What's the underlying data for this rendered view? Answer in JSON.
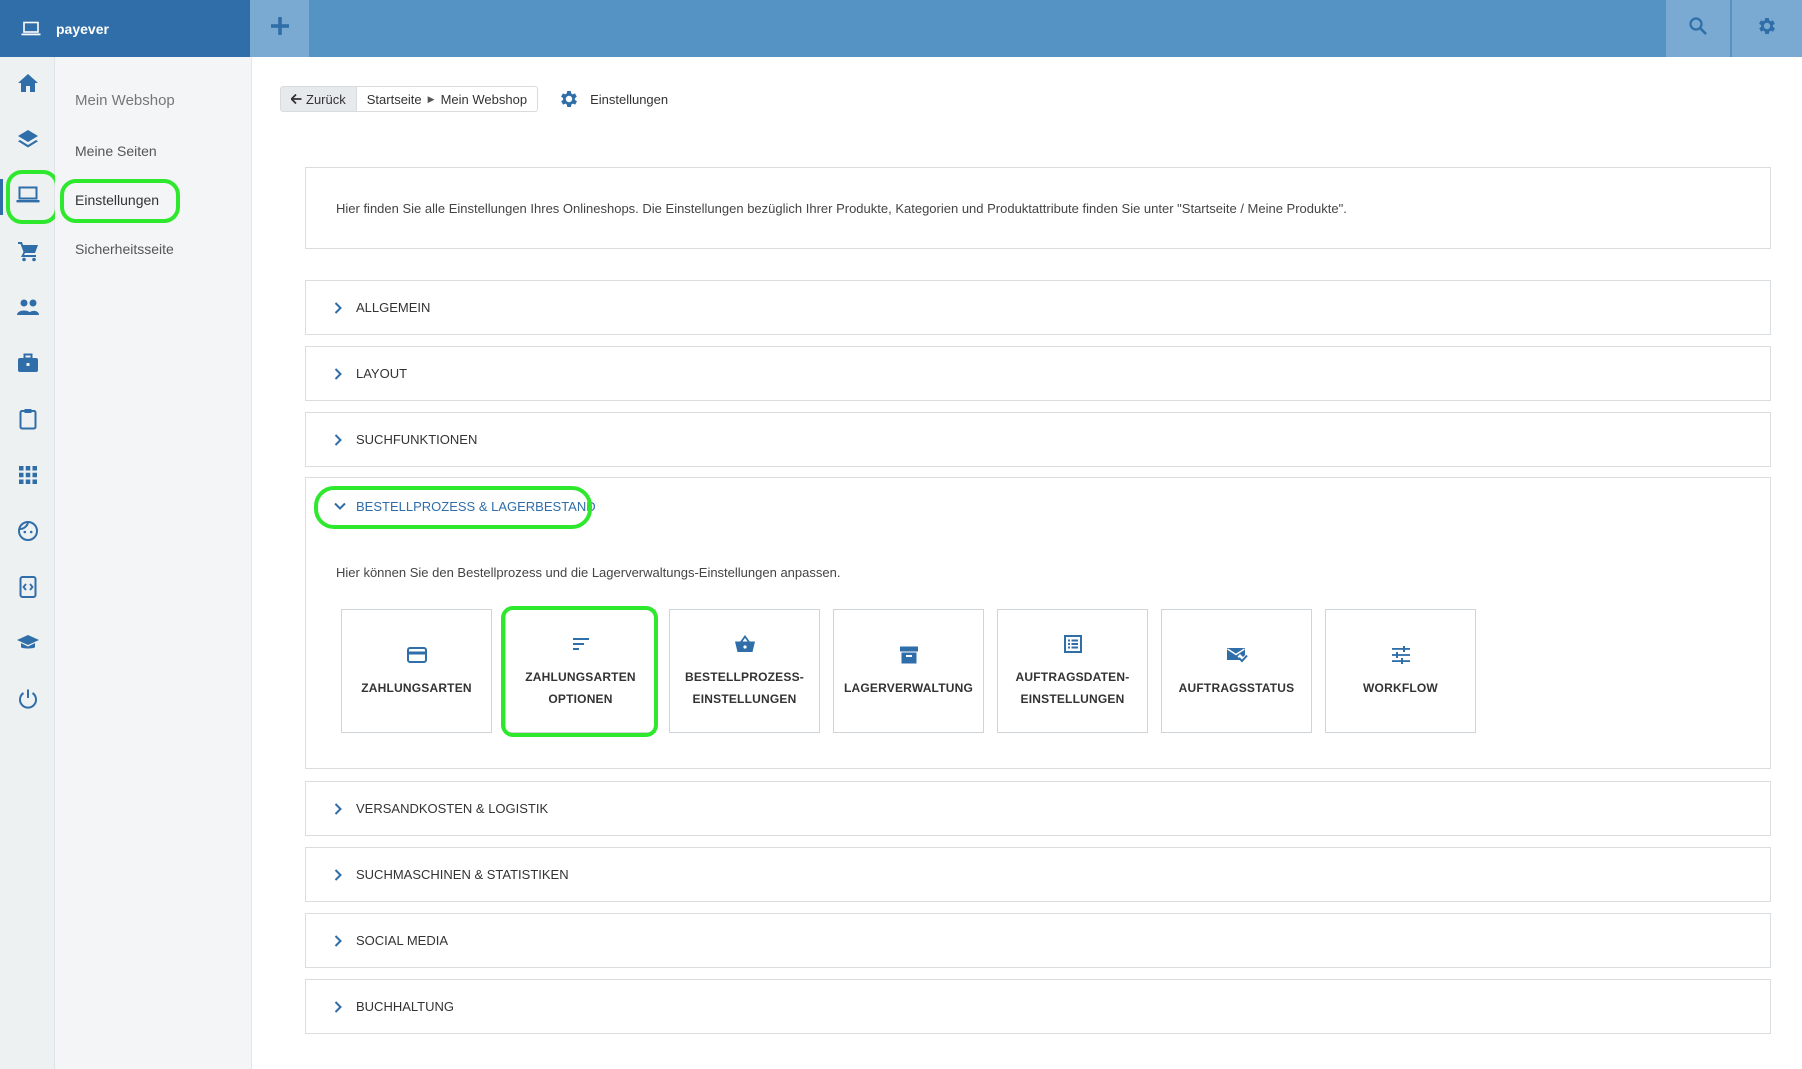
{
  "app": {
    "brand_name": "payever",
    "accent_color": "#2f6ea8",
    "topbar_color": "#5693c5",
    "highlight_color": "#2ee82e"
  },
  "topbar": {
    "add_icon": "plus-icon",
    "search_icon": "search-icon",
    "settings_icon": "gear-icon"
  },
  "rail": {
    "items": [
      {
        "icon": "home-icon"
      },
      {
        "icon": "layers-icon"
      },
      {
        "icon": "laptop-icon",
        "active": true
      },
      {
        "icon": "cart-icon"
      },
      {
        "icon": "people-icon"
      },
      {
        "icon": "briefcase-icon"
      },
      {
        "icon": "clipboard-icon"
      },
      {
        "icon": "apps-grid-icon"
      },
      {
        "icon": "face-icon"
      },
      {
        "icon": "code-device-icon"
      },
      {
        "icon": "graduation-cap-icon"
      },
      {
        "icon": "power-icon"
      }
    ]
  },
  "subnav": {
    "title": "Mein Webshop",
    "items": [
      {
        "label": "Meine Seiten"
      },
      {
        "label": "Einstellungen",
        "active": true
      },
      {
        "label": "Sicherheitsseite"
      }
    ]
  },
  "breadcrumb": {
    "back_label": "Zurück",
    "crumbs": [
      "Startseite",
      "Mein Webshop"
    ],
    "page_title": "Einstellungen"
  },
  "intro_text": "Hier finden Sie alle Einstellungen Ihres Onlineshops. Die Einstellungen bezüglich Ihrer Produkte, Kategorien und Produktattribute finden Sie unter \"Startseite / Meine Produkte\".",
  "sections": {
    "before": [
      {
        "label": "ALLGEMEIN"
      },
      {
        "label": "LAYOUT"
      },
      {
        "label": "SUCHFUNKTIONEN"
      }
    ],
    "open": {
      "label": "BESTELLPROZESS & LAGERBESTAND",
      "description": "Hier können Sie den Bestellprozess und die Lagerverwaltungs-Einstellungen anpassen.",
      "tiles": [
        {
          "line1": "ZAHLUNGSARTEN",
          "line2": "",
          "icon": "credit-card-icon"
        },
        {
          "line1": "ZAHLUNGSARTEN",
          "line2": "OPTIONEN",
          "icon": "sort-lines-icon"
        },
        {
          "line1": "BESTELLPROZESS-",
          "line2": "EINSTELLUNGEN",
          "icon": "basket-icon"
        },
        {
          "line1": "LAGERVERWALTUNG",
          "line2": "",
          "icon": "archive-box-icon"
        },
        {
          "line1": "AUFTRAGSDATEN-",
          "line2": "EINSTELLUNGEN",
          "icon": "list-document-icon"
        },
        {
          "line1": "AUFTRAGSSTATUS",
          "line2": "",
          "icon": "mail-check-icon"
        },
        {
          "line1": "WORKFLOW",
          "line2": "",
          "icon": "sliders-icon"
        }
      ]
    },
    "after": [
      {
        "label": "VERSANDKOSTEN & LOGISTIK"
      },
      {
        "label": "SUCHMASCHINEN & STATISTIKEN"
      },
      {
        "label": "SOCIAL MEDIA"
      },
      {
        "label": "BUCHHALTUNG"
      }
    ]
  }
}
